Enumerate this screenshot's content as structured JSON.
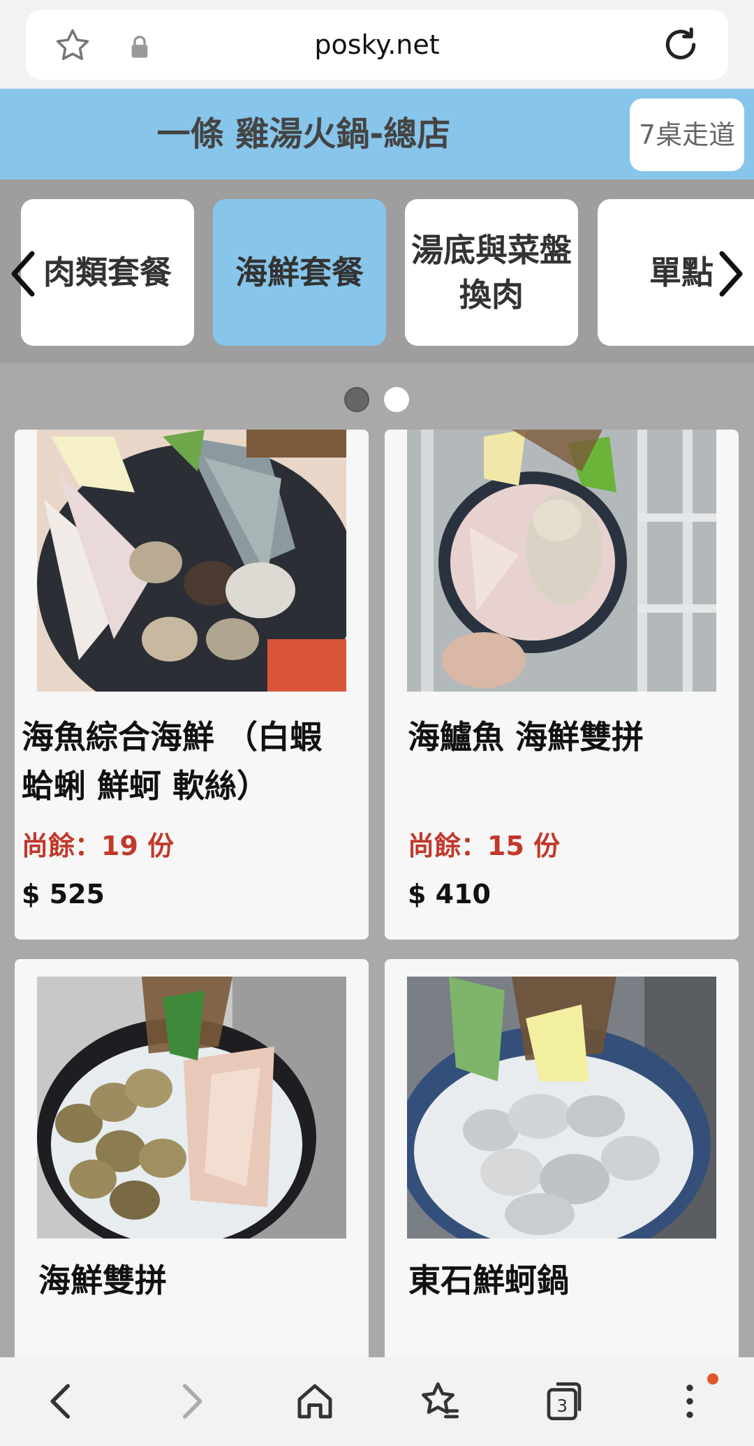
{
  "browser": {
    "url": "posky.net",
    "tab_count": "3"
  },
  "header": {
    "title": "一條 雞湯火鍋-總店",
    "table_label": "7桌走道"
  },
  "categories": [
    {
      "label": "肉類套餐",
      "active": false
    },
    {
      "label": "海鮮套餐",
      "active": true
    },
    {
      "label": "湯底與菜盤換肉",
      "active": false
    },
    {
      "label": "單點",
      "active": false
    }
  ],
  "carousel": {
    "page": 1,
    "pages": 2
  },
  "products": [
    {
      "name": "海魚綜合海鮮 （白蝦 蛤蜊 鮮蚵 軟絲）",
      "stock": "尚餘：19 份",
      "price": "$ 525"
    },
    {
      "name": "海鱸魚 海鮮雙拼",
      "stock": "尚餘：15 份",
      "price": "$ 410"
    },
    {
      "name": "海鮮雙拼"
    },
    {
      "name": "東石鮮蚵鍋"
    }
  ],
  "colors": {
    "accent_blue": "#87c5ea",
    "stock_red": "#c0392b",
    "notification": "#e0572b"
  }
}
